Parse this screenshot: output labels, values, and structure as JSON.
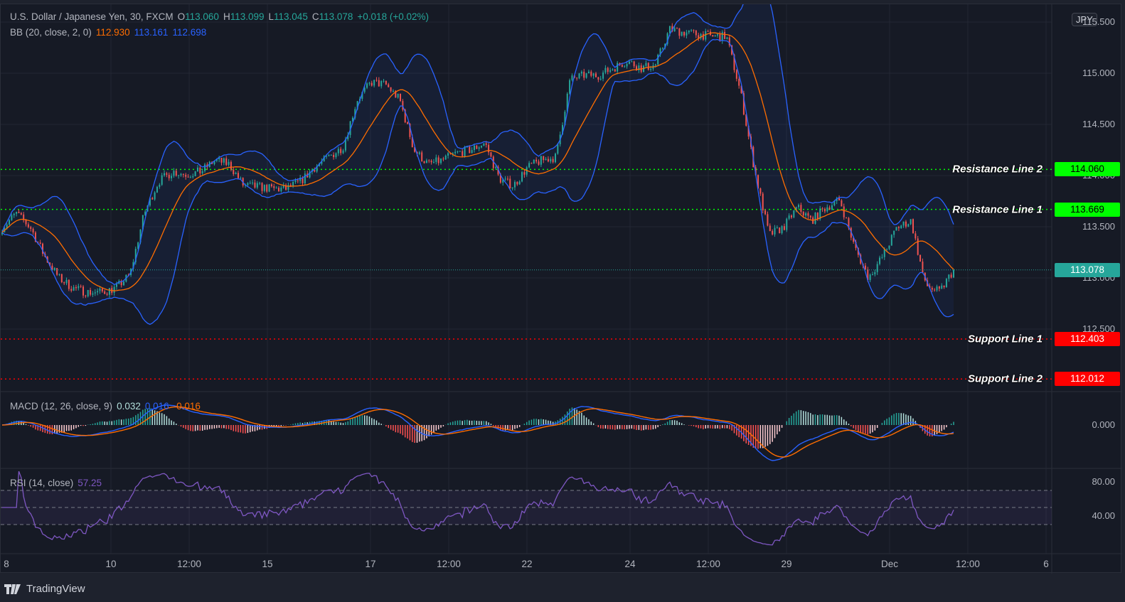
{
  "header": {
    "symbol": "U.S. Dollar / Japanese Yen, 30, FXCM",
    "open_label": "O",
    "open": "113.060",
    "high_label": "H",
    "high": "113.099",
    "low_label": "L",
    "low": "113.045",
    "close_label": "C",
    "close": "113.078",
    "change": "+0.018 (+0.02%)"
  },
  "bb_legend": {
    "label": "BB (20, close, 2, 0)",
    "basis": "112.930",
    "upper": "113.161",
    "lower": "112.698"
  },
  "macd_legend": {
    "label": "MACD (12, 26, close, 9)",
    "hist": "0.032",
    "macd": "0.016",
    "signal": "-0.016"
  },
  "rsi_legend": {
    "label": "RSI (14, close)",
    "value": "57.25"
  },
  "currency_badge": "JPY",
  "footer": {
    "brand": "TradingView"
  },
  "colors": {
    "up": "#26a69a",
    "down": "#ef5350",
    "bb_band": "#2962ff",
    "bb_basis": "#ff6d00",
    "macd": "#2962ff",
    "signal": "#ff6d00",
    "rsi": "#7e57c2",
    "resistance": "#00ff00",
    "support": "#ff0000",
    "background": "#161a25"
  },
  "chart_data": {
    "type": "candlestick",
    "symbol": "USDJPY",
    "timeframe": "30",
    "x_tick_labels": [
      "8",
      "10",
      "12:00",
      "15",
      "17",
      "12:00",
      "22",
      "24",
      "12:00",
      "29",
      "Dec",
      "12:00",
      "6"
    ],
    "price_axis": {
      "ticks": [
        "115.500",
        "115.000",
        "114.500",
        "114.000",
        "113.500",
        "113.000",
        "112.500"
      ],
      "range": [
        111.95,
        115.56
      ]
    },
    "approx_close_path": [
      113.49,
      113.63,
      113.49,
      113.21,
      113.0,
      112.9,
      112.86,
      112.86,
      112.9,
      113.03,
      113.63,
      113.94,
      114.04,
      114.01,
      114.04,
      114.15,
      114.11,
      113.9,
      113.89,
      113.87,
      113.87,
      113.94,
      114.08,
      114.18,
      114.28,
      114.74,
      114.91,
      114.89,
      114.74,
      114.25,
      114.11,
      114.15,
      114.22,
      114.25,
      114.32,
      113.97,
      113.9,
      114.08,
      114.15,
      114.18,
      114.94,
      114.98,
      114.98,
      115.05,
      115.12,
      115.05,
      115.08,
      115.43,
      115.4,
      115.38,
      115.36,
      115.36,
      114.81,
      114.04,
      113.42,
      113.49,
      113.69,
      113.56,
      113.69,
      113.76,
      113.31,
      113.0,
      113.21,
      113.49,
      113.56,
      112.93,
      112.86,
      113.08
    ],
    "last_price": 113.078,
    "levels": [
      {
        "name": "Resistance Line 2",
        "value": "114.060",
        "type": "resistance"
      },
      {
        "name": "Resistance Line 1",
        "value": "113.669",
        "type": "resistance"
      },
      {
        "name": "Support Line 1",
        "value": "112.403",
        "type": "support"
      },
      {
        "name": "Support Line 2",
        "value": "112.012",
        "type": "support"
      }
    ],
    "macd_axis": {
      "ticks": [
        "0.000"
      ]
    },
    "rsi_axis": {
      "ticks": [
        "80.00",
        "40.00"
      ],
      "bands": [
        30,
        50,
        70
      ],
      "range": [
        0,
        100
      ]
    }
  }
}
